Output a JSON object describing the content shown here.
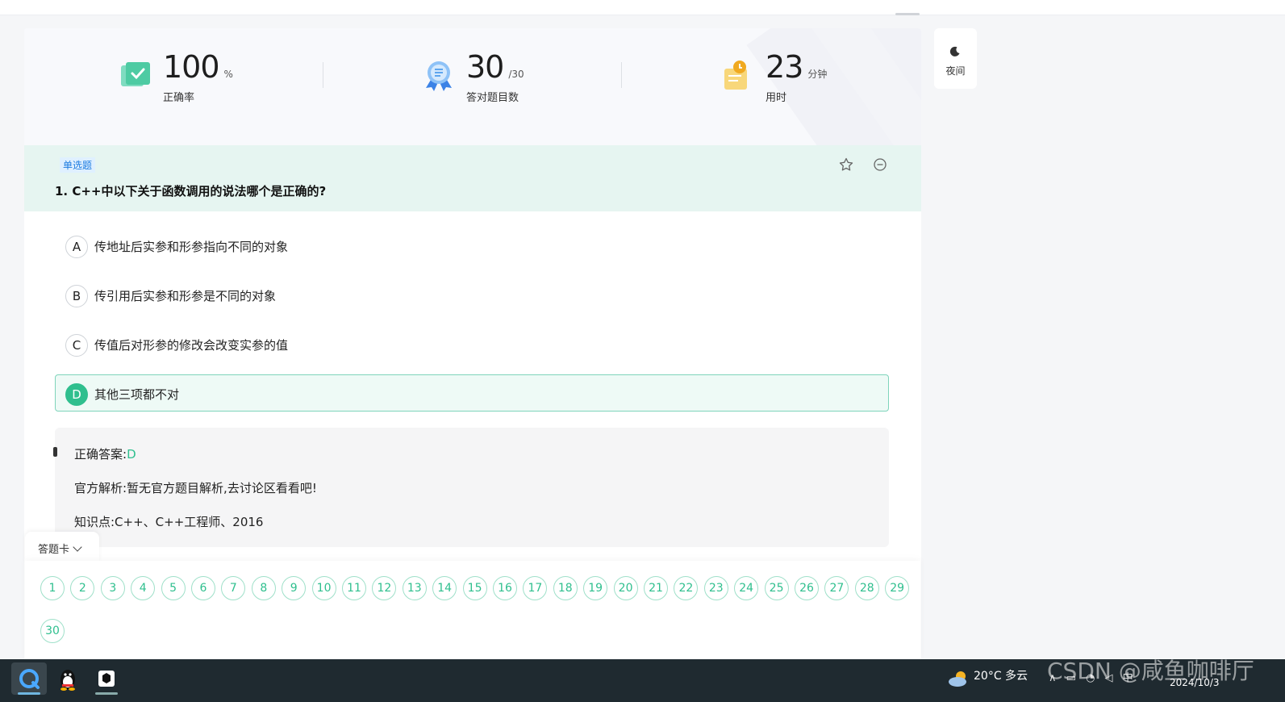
{
  "stats": [
    {
      "value": "100",
      "unit": "%",
      "label": "正确率",
      "icon": "check-badge-icon"
    },
    {
      "value": "30",
      "unit": "/30",
      "label": "答对题目数",
      "icon": "ribbon-medal-icon"
    },
    {
      "value": "23",
      "unit": "分钟",
      "label": "用时",
      "icon": "clock-timer-icon"
    }
  ],
  "question": {
    "type": "单选题",
    "title": "1. C++中以下关于函数调用的说法哪个是正确的?",
    "options": [
      {
        "letter": "A",
        "text": "传地址后实参和形参指向不同的对象"
      },
      {
        "letter": "B",
        "text": "传引用后实参和形参是不同的对象"
      },
      {
        "letter": "C",
        "text": "传值后对形参的修改会改变实参的值"
      },
      {
        "letter": "D",
        "text": "其他三项都不对"
      }
    ],
    "selected": "D"
  },
  "answer": {
    "correct_label": "正确答案:",
    "correct_value": "D",
    "analysis": "官方解析:暂无官方题目解析,去讨论区看看吧!",
    "knowledge": "知识点:C++、C++工程师、2016"
  },
  "answer_card": {
    "tab_label": "答题卡",
    "numbers": [
      "1",
      "2",
      "3",
      "4",
      "5",
      "6",
      "7",
      "8",
      "9",
      "10",
      "11",
      "12",
      "13",
      "14",
      "15",
      "16",
      "17",
      "18",
      "19",
      "20",
      "21",
      "22",
      "23",
      "24",
      "25",
      "26",
      "27",
      "28",
      "29",
      "30"
    ]
  },
  "night_mode": {
    "label": "夜间"
  },
  "taskbar": {
    "weather": "20°C  多云",
    "date": "2024/10/3",
    "tray_glyphs": "∧ ▭ ◔ ◁ 中"
  },
  "watermark": "CSDN @咸鱼咖啡厅",
  "colors": {
    "accent": "#2fbf8e",
    "question_bg": "#e6f5f1",
    "link_blue": "#1c7be0"
  }
}
